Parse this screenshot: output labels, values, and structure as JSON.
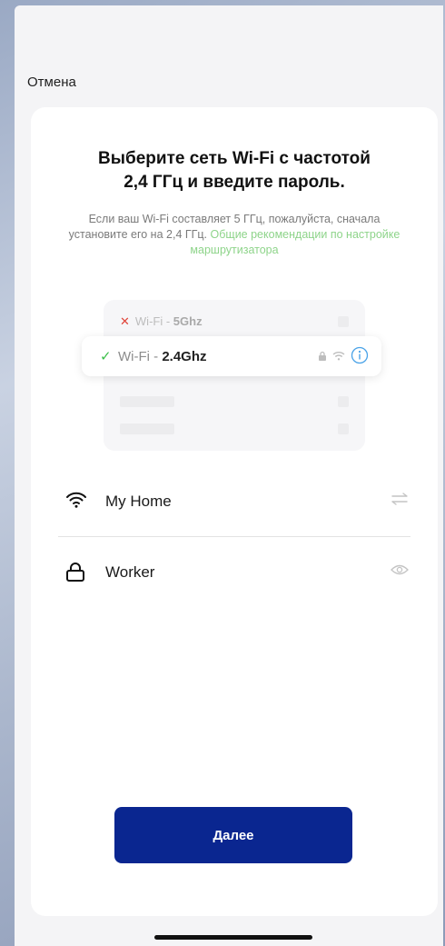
{
  "header": {
    "cancel_label": "Отмена"
  },
  "main": {
    "title_line1": "Выберите сеть Wi-Fi с частотой",
    "title_line2": "2,4 ГГц и введите пароль.",
    "subtitle_text": "Если ваш Wi-Fi составляет 5 ГГц, пожалуйста, сначала установите его на 2,4 ГГц.",
    "subtitle_link": "Общие рекомендации по настройке маршрутизатора"
  },
  "illustration": {
    "bad_prefix": "Wi-Fi - ",
    "bad_band": "5Ghz",
    "good_prefix": "Wi-Fi - ",
    "good_band": "2.4Ghz"
  },
  "form": {
    "network_name": "My Home",
    "password": "Worker"
  },
  "footer": {
    "next_label": "Далее"
  },
  "colors": {
    "accent": "#0a2690",
    "link": "#8ed48a",
    "ok": "#3cbf4a",
    "error": "#e0453a",
    "info": "#4aa3e8"
  }
}
